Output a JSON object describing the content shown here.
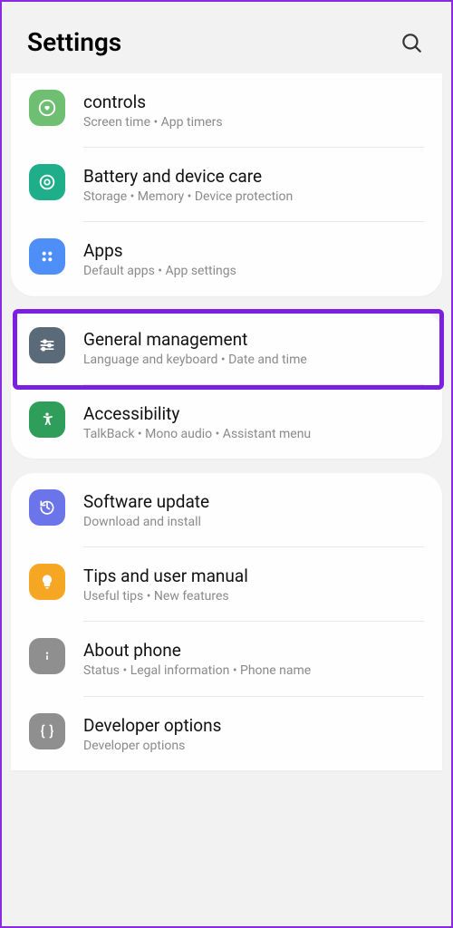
{
  "header": {
    "title": "Settings"
  },
  "groups": [
    {
      "items": [
        {
          "id": "controls",
          "title": "controls",
          "subtitle": "Screen time  •  App timers",
          "iconColor": "#6fbf73",
          "iconName": "heart-circle-icon"
        },
        {
          "id": "battery",
          "title": "Battery and device care",
          "subtitle": "Storage  •  Memory  •  Device protection",
          "iconColor": "#1fae8a",
          "iconName": "care-icon"
        },
        {
          "id": "apps",
          "title": "Apps",
          "subtitle": "Default apps  •  App settings",
          "iconColor": "#4d8ef7",
          "iconName": "apps-icon"
        }
      ]
    },
    {
      "items": [
        {
          "id": "general",
          "title": "General management",
          "subtitle": "Language and keyboard  •  Date and time",
          "iconColor": "#5b6a78",
          "iconName": "sliders-icon",
          "highlighted": true
        },
        {
          "id": "accessibility",
          "title": "Accessibility",
          "subtitle": "TalkBack  •  Mono audio  •  Assistant menu",
          "iconColor": "#2f9e5a",
          "iconName": "accessibility-icon"
        }
      ]
    },
    {
      "items": [
        {
          "id": "software",
          "title": "Software update",
          "subtitle": "Download and install",
          "iconColor": "#6b74e8",
          "iconName": "update-icon"
        },
        {
          "id": "tips",
          "title": "Tips and user manual",
          "subtitle": "Useful tips  •  New features",
          "iconColor": "#f5a623",
          "iconName": "bulb-icon"
        },
        {
          "id": "about",
          "title": "About phone",
          "subtitle": "Status  •  Legal information  •  Phone name",
          "iconColor": "#8f8f8f",
          "iconName": "info-icon"
        },
        {
          "id": "developer",
          "title": "Developer options",
          "subtitle": "Developer options",
          "iconColor": "#8f8f8f",
          "iconName": "braces-icon"
        }
      ]
    }
  ]
}
